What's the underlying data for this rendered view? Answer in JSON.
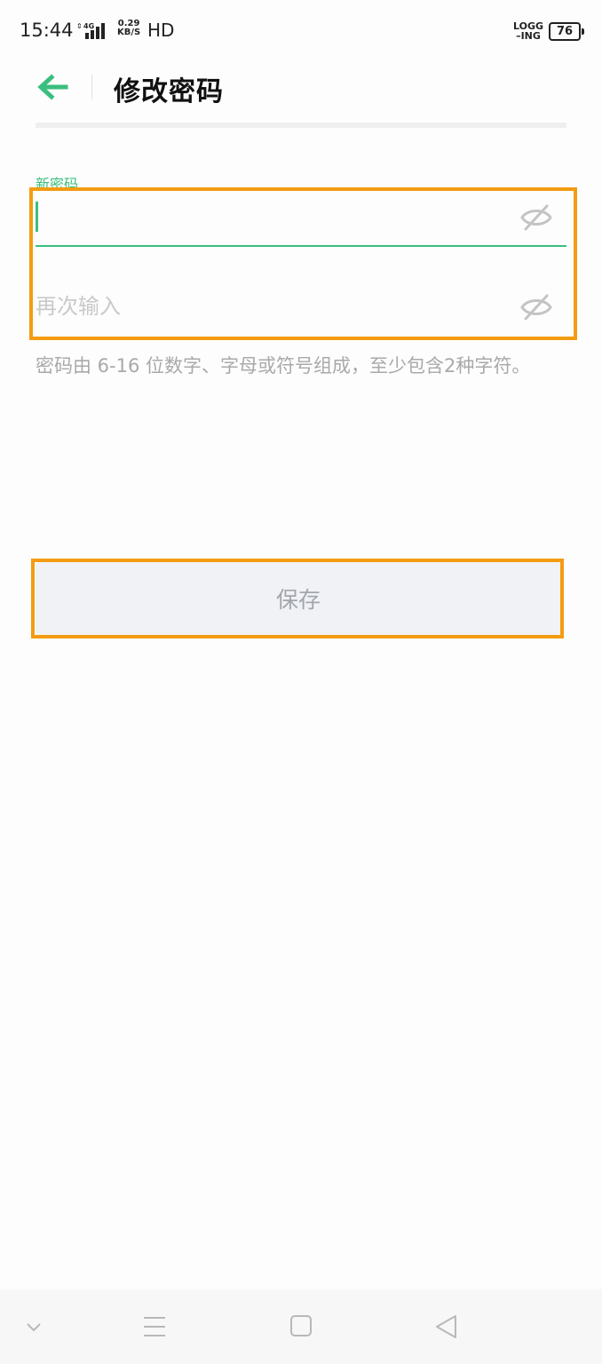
{
  "status_bar": {
    "time": "15:44",
    "network_type": "4G",
    "net_speed_value": "0.29",
    "net_speed_unit": "KB/S",
    "hd_label": "HD",
    "logging_line1": "LOGG",
    "logging_line2": "–ING",
    "battery_level": "76"
  },
  "header": {
    "back_icon": "arrow-left-icon",
    "title": "修改密码"
  },
  "form": {
    "new_password": {
      "label": "新密码",
      "value": "",
      "placeholder": "",
      "toggle_icon": "eye-off-icon"
    },
    "confirm_password": {
      "value": "",
      "placeholder": "再次输入",
      "toggle_icon": "eye-off-icon"
    },
    "hint": "密码由 6-16 位数字、字母或符号组成，至少包含2种字符。"
  },
  "save_button": {
    "label": "保存"
  },
  "nav_bar": {
    "items": [
      {
        "icon": "chevron-down-icon"
      },
      {
        "icon": "menu-icon"
      },
      {
        "icon": "home-square-icon"
      },
      {
        "icon": "back-triangle-icon"
      }
    ]
  },
  "colors": {
    "accent": "#3bbf7e",
    "highlight": "#f39c12",
    "hint_text": "#a9a9a9",
    "button_bg": "#f1f2f5",
    "button_text": "#a2a6ad"
  }
}
